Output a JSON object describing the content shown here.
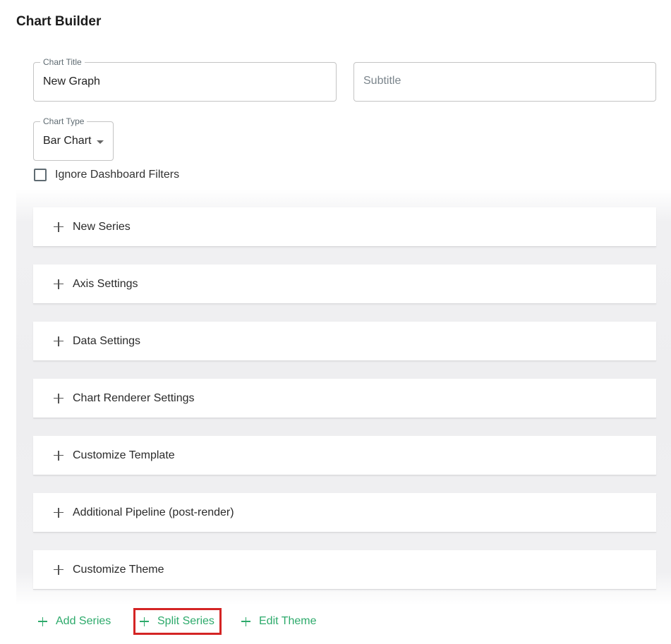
{
  "page": {
    "title": "Chart Builder"
  },
  "form": {
    "chart_title": {
      "legend": "Chart Title",
      "value": "New Graph"
    },
    "subtitle": {
      "placeholder": "Subtitle",
      "value": ""
    },
    "chart_type": {
      "legend": "Chart Type",
      "value": "Bar Chart"
    },
    "ignore_filters": {
      "label": "Ignore Dashboard Filters",
      "checked": false
    }
  },
  "sections": [
    {
      "label": "New Series",
      "icon": "plus-icon"
    },
    {
      "label": "Axis Settings",
      "icon": "plus-icon"
    },
    {
      "label": "Data Settings",
      "icon": "plus-icon"
    },
    {
      "label": "Chart Renderer Settings",
      "icon": "plus-icon"
    },
    {
      "label": "Customize Template",
      "icon": "plus-icon"
    },
    {
      "label": "Additional Pipeline (post-render)",
      "icon": "plus-icon"
    },
    {
      "label": "Customize Theme",
      "icon": "plus-icon"
    }
  ],
  "actions": {
    "add_series": {
      "label": "Add Series",
      "icon": "plus-icon"
    },
    "split_series": {
      "label": "Split Series",
      "icon": "plus-icon",
      "highlighted": true
    },
    "edit_theme": {
      "label": "Edit Theme",
      "icon": "plus-icon"
    }
  },
  "colors": {
    "accent_green": "#2daa6b",
    "highlight_red": "#d42424",
    "border_gray": "#c4c4c4"
  }
}
